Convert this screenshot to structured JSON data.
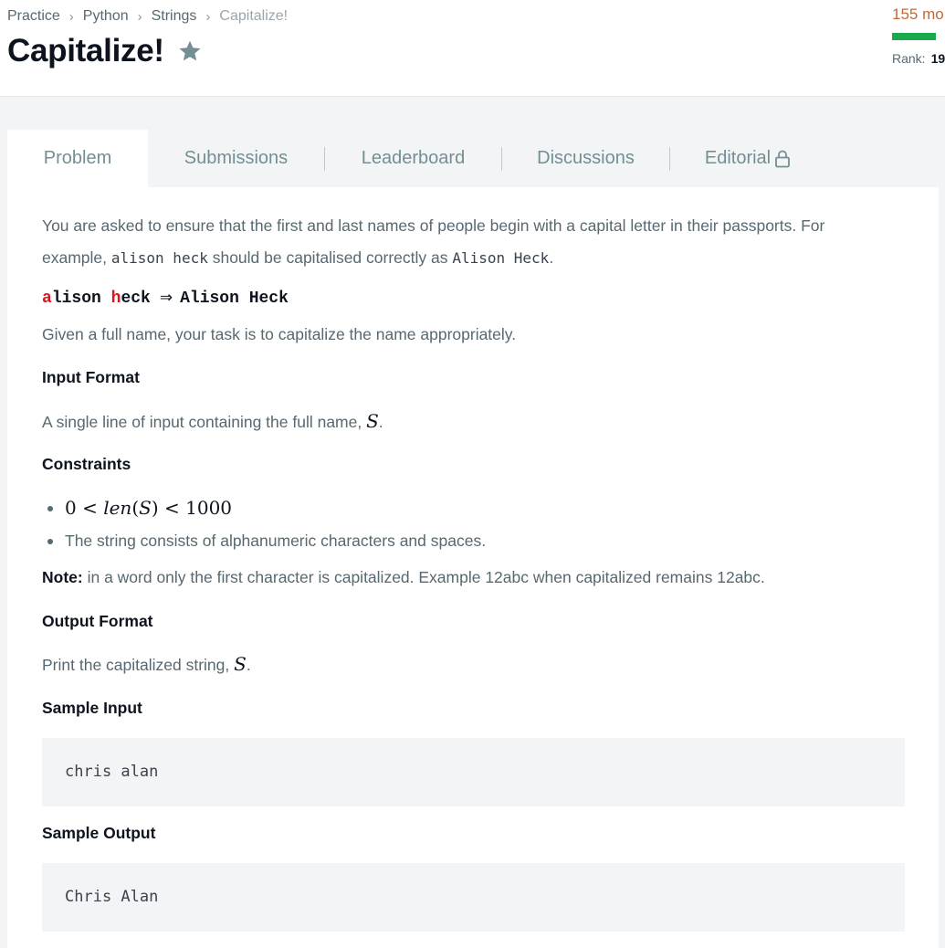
{
  "breadcrumb": {
    "items": [
      "Practice",
      "Python",
      "Strings"
    ],
    "current": "Capitalize!"
  },
  "title": "Capitalize!",
  "progress": {
    "points": "155 mo",
    "rank_label": "Rank:",
    "rank_value": "19",
    "fill_percent": 100
  },
  "tabs": [
    "Problem",
    "Submissions",
    "Leaderboard",
    "Discussions",
    "Editorial"
  ],
  "problem": {
    "intro_1": "You are asked to ensure that the first and last names of people begin with a capital letter in their passports. For",
    "intro_2a": "example, ",
    "intro_2_code1": "alison heck",
    "intro_2b": " should be capitalised correctly as ",
    "intro_2_code2": "Alison Heck",
    "intro_2c": ".",
    "example": {
      "src_a_red": "a",
      "src_a_rest": "lison ",
      "src_h_red": "h",
      "src_h_rest": "eck",
      "arrow": "⇒",
      "dst": "Alison Heck"
    },
    "task": "Given a full name, your task is to capitalize the name appropriately.",
    "input_format_heading": "Input Format",
    "input_format_text": "A single line of input containing the full name, ",
    "input_format_var": "S",
    "input_format_end": ".",
    "constraints_heading": "Constraints",
    "constraint_1": {
      "lhs": "0 < ",
      "fn": "len",
      "lp": "(",
      "var": "S",
      "rp": ")",
      "rhs": " < 1000"
    },
    "constraint_2": "The string consists of alphanumeric characters and spaces.",
    "note_label": "Note:",
    "note_text": " in a word only the first character is capitalized. Example 12abc when capitalized remains 12abc.",
    "output_format_heading": "Output Format",
    "output_format_text": "Print the capitalized string, ",
    "output_format_var": "S",
    "output_format_end": ".",
    "sample_input_heading": "Sample Input",
    "sample_input": "chris alan",
    "sample_output_heading": "Sample Output",
    "sample_output": "Chris Alan"
  },
  "colors": {
    "accent_green": "#1ba94c",
    "points_orange": "#c06a3c",
    "example_red": "#e0121a"
  }
}
